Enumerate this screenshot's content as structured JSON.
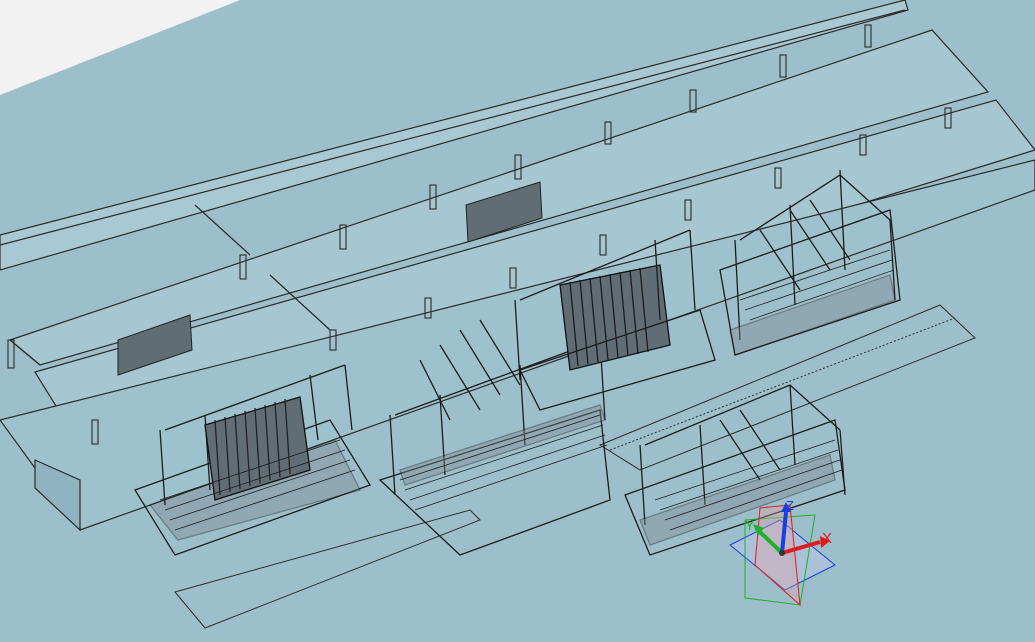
{
  "app": {
    "title": ""
  },
  "viewport": {
    "background": "#9dbfcc",
    "corner_background": "#f2f2f2",
    "model_outline": "#2b2b2b",
    "panel_fill": "#606d74"
  },
  "triad": {
    "x_label": "X",
    "y_label": "Y",
    "z_label": "Z",
    "x_color": "#e01b1b",
    "y_color": "#1fb02a",
    "z_color": "#1a3fe0"
  }
}
